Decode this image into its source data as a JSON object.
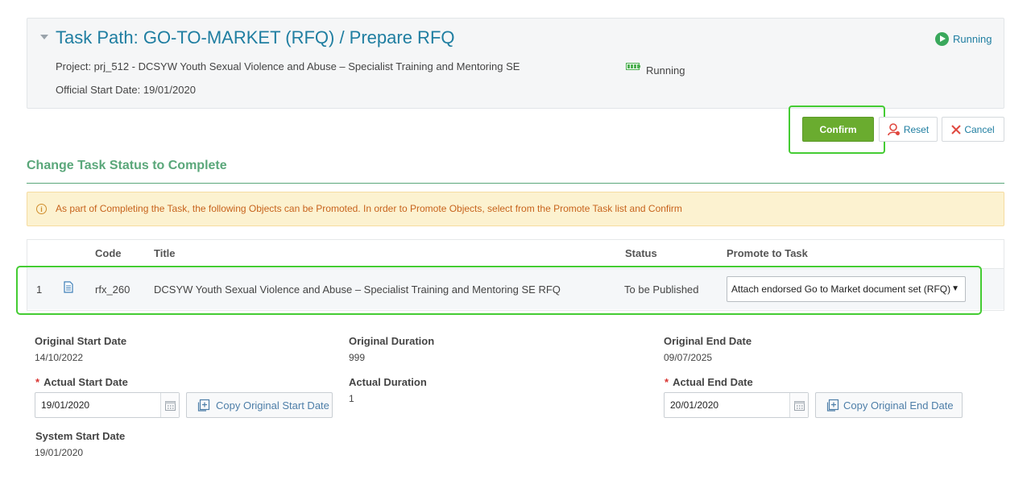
{
  "header": {
    "title": "Task Path: GO-TO-MARKET (RFQ) / Prepare RFQ",
    "project": "Project: prj_512 - DCSYW Youth Sexual Violence and Abuse – Specialist Training and Mentoring SE",
    "official_start": "Official Start Date: 19/01/2020",
    "status_mid": "Running",
    "status_top": "Running",
    "colors": {
      "title": "#1f7ea1",
      "running": "#3aa85c"
    }
  },
  "actions": {
    "confirm": "Confirm",
    "reset": "Reset",
    "cancel": "Cancel",
    "colors": {
      "confirm": "#6aac2f",
      "highlight": "#44cc33"
    }
  },
  "section": {
    "title": "Change Task Status to Complete"
  },
  "warning": {
    "icon": "info-circle-icon",
    "text": "As part of Completing the Task, the following Objects can be Promoted. In order to Promote Objects, select from the Promote Task list and Confirm"
  },
  "table": {
    "headers": {
      "code": "Code",
      "title": "Title",
      "status": "Status",
      "promote": "Promote to Task"
    },
    "rows": [
      {
        "num": "1",
        "icon": "document-icon",
        "code": "rfx_260",
        "title": "DCSYW Youth Sexual Violence and Abuse – Specialist Training and Mentoring SE RFQ",
        "status": "To be Published",
        "promote": "Attach endorsed Go to Market document set (RFQ)"
      }
    ]
  },
  "dates": {
    "original_start_label": "Original Start Date",
    "original_start": "14/10/2022",
    "original_duration_label": "Original Duration",
    "original_duration": "999",
    "original_end_label": "Original End Date",
    "original_end": "09/07/2025",
    "required_marker": "*",
    "actual_start_label": "Actual Start Date",
    "actual_start": "19/01/2020",
    "actual_duration_label": "Actual Duration",
    "actual_duration": "1",
    "actual_end_label": "Actual End Date",
    "actual_end": "20/01/2020",
    "copy_start": "Copy Original Start Date",
    "copy_end": "Copy Original End Date",
    "system_start_label": "System Start Date",
    "system_start": "19/01/2020"
  }
}
